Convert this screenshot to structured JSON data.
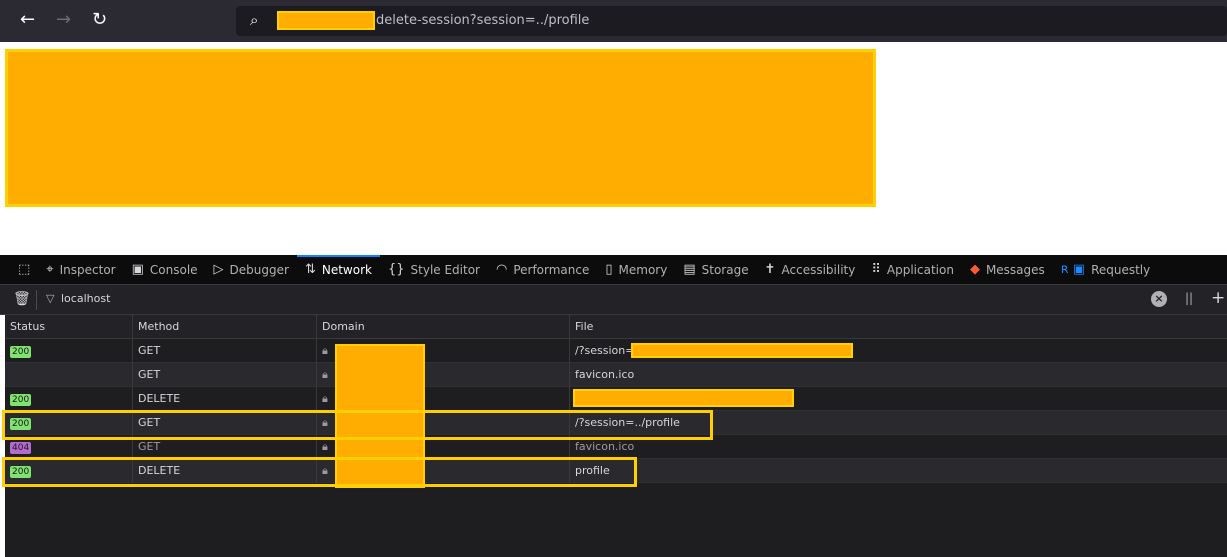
{
  "browser": {
    "url_suffix": "delete-session?session=../profile",
    "icons": [
      "back-arrow-icon",
      "forward-arrow-icon",
      "reload-icon",
      "search-icon"
    ]
  },
  "devtools": {
    "tabs": [
      {
        "label": "Inspector",
        "icon": "inspector-icon"
      },
      {
        "label": "Console",
        "icon": "console-icon"
      },
      {
        "label": "Debugger",
        "icon": "debugger-icon"
      },
      {
        "label": "Network",
        "icon": "network-arrows-icon",
        "active": true
      },
      {
        "label": "Style Editor",
        "icon": "braces-icon"
      },
      {
        "label": "Performance",
        "icon": "gauge-icon"
      },
      {
        "label": "Memory",
        "icon": "chip-icon"
      },
      {
        "label": "Storage",
        "icon": "cabinet-icon"
      },
      {
        "label": "Accessibility",
        "icon": "person-icon"
      },
      {
        "label": "Application",
        "icon": "grid-icon"
      },
      {
        "label": "Messages",
        "icon": "fox-icon"
      },
      {
        "label": "Requestly",
        "icon": "requestly-icon"
      }
    ],
    "filter": "localhost",
    "columns": [
      "Status",
      "Method",
      "Domain",
      "File"
    ],
    "rows": [
      {
        "status": "200",
        "method": "GET",
        "file": "/?session="
      },
      {
        "status": "",
        "method": "GET",
        "file": "favicon.ico"
      },
      {
        "status": "200",
        "method": "DELETE",
        "file": ""
      },
      {
        "status": "200",
        "method": "GET",
        "file": "/?session=../profile"
      },
      {
        "status": "404",
        "method": "GET",
        "file": "favicon.ico"
      },
      {
        "status": "200",
        "method": "DELETE",
        "file": "profile"
      }
    ],
    "colors": {
      "ok": "#7ee36f",
      "notfound": "#b36bcf",
      "highlight": "#ffd000",
      "redaction": "#ffad00"
    }
  }
}
